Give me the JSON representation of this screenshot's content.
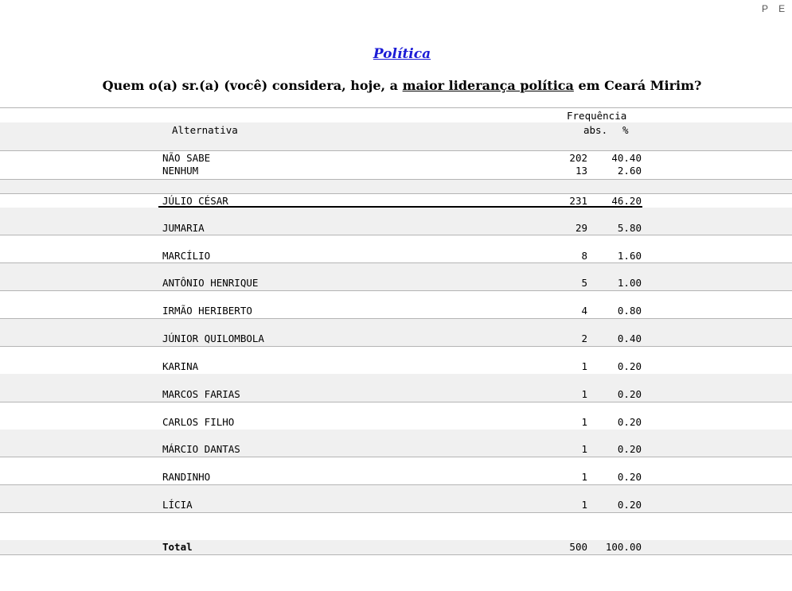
{
  "corner_text": "P E S",
  "section_link": "Política",
  "question": {
    "before": "Quem o(a) sr.(a) (você) considera, hoje, a ",
    "underlined": "maior liderança política",
    "after": " em Ceará Mirim?"
  },
  "table": {
    "header_frequencia": "Frequência",
    "header_alternativa": "Alternativa",
    "header_abs": "abs.",
    "header_pct": "%",
    "rows": [
      {
        "label": "NÃO SABE",
        "abs": "202",
        "pct": "40.40"
      },
      {
        "label": "NENHUM",
        "abs": "13",
        "pct": "2.60"
      },
      {
        "label": "JÚLIO CÉSAR",
        "abs": "231",
        "pct": "46.20"
      },
      {
        "label": "JUMARIA",
        "abs": "29",
        "pct": "5.80"
      },
      {
        "label": "MARCÍLIO",
        "abs": "8",
        "pct": "1.60"
      },
      {
        "label": "ANTÔNIO HENRIQUE",
        "abs": "5",
        "pct": "1.00"
      },
      {
        "label": "IRMÃO HERIBERTO",
        "abs": "4",
        "pct": "0.80"
      },
      {
        "label": "JÚNIOR QUILOMBOLA",
        "abs": "2",
        "pct": "0.40"
      },
      {
        "label": "KARINA",
        "abs": "1",
        "pct": "0.20"
      },
      {
        "label": "MARCOS FARIAS",
        "abs": "1",
        "pct": "0.20"
      },
      {
        "label": "CARLOS FILHO",
        "abs": "1",
        "pct": "0.20"
      },
      {
        "label": "MÁRCIO DANTAS",
        "abs": "1",
        "pct": "0.20"
      },
      {
        "label": "RANDINHO",
        "abs": "1",
        "pct": "0.20"
      },
      {
        "label": "LÍCIA",
        "abs": "1",
        "pct": "0.20"
      }
    ],
    "total": {
      "label": "Total",
      "abs": "500",
      "pct": "100.00"
    }
  }
}
